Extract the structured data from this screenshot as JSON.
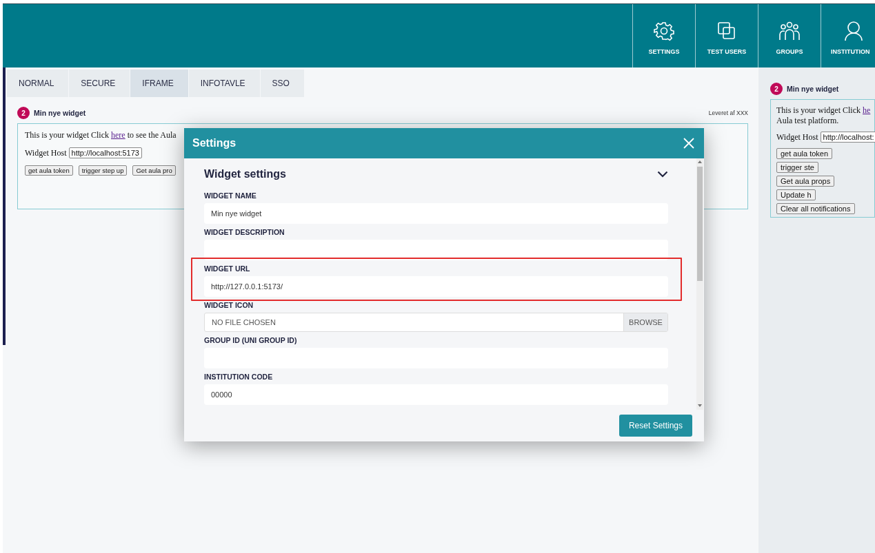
{
  "header": {
    "nav": [
      {
        "label": "SETTINGS"
      },
      {
        "label": "TEST USERS"
      },
      {
        "label": "GROUPS"
      },
      {
        "label": "INSTITUTION"
      }
    ]
  },
  "tabs": [
    {
      "label": "NORMAL",
      "selected": false
    },
    {
      "label": "SECURE",
      "selected": false
    },
    {
      "label": "IFRAME",
      "selected": true
    },
    {
      "label": "INFOTAVLE",
      "selected": false
    },
    {
      "label": "SSO",
      "selected": false
    }
  ],
  "widget": {
    "badge": "2",
    "title": "Min nye widget",
    "provider": "Leveret af XXX",
    "text_before": "This is your widget Click",
    "link": "here",
    "text_after": "to see the Aula",
    "host_label": "Widget Host",
    "host_value": "http://localhost:5173",
    "buttons": [
      "get aula token",
      "trigger step up",
      "Get aula pro"
    ]
  },
  "side_widget": {
    "badge": "2",
    "title": "Min nye widget",
    "text_before": "This is your widget Click",
    "link": "he",
    "text_line2": "Aula test platform.",
    "host_label": "Widget Host",
    "host_value": "http://localhost:",
    "buttons": [
      "get aula token",
      "trigger ste",
      "Get aula props",
      "Update h",
      "Clear all notifications"
    ]
  },
  "modal": {
    "title": "Settings",
    "section": {
      "title": "Widget settings",
      "expanded": true
    },
    "fields": [
      {
        "kind": "text",
        "label": "WIDGET NAME",
        "value": "Min nye widget",
        "highlighted": false
      },
      {
        "kind": "text",
        "label": "WIDGET DESCRIPTION",
        "highlighted": false
      },
      {
        "kind": "text",
        "label": "WIDGET URL",
        "value": "http://127.0.0.1:5173/",
        "highlighted": true
      },
      {
        "kind": "file",
        "label": "WIDGET ICON",
        "status": "NO FILE CHOSEN",
        "button": "BROWSE",
        "highlighted": false
      },
      {
        "kind": "text",
        "label": "GROUP ID (UNI GROUP ID)",
        "highlighted": false
      },
      {
        "kind": "text",
        "label": "INSTITUTION CODE",
        "value": "00000",
        "highlighted": false
      }
    ],
    "reset_button": "Reset Settings"
  }
}
